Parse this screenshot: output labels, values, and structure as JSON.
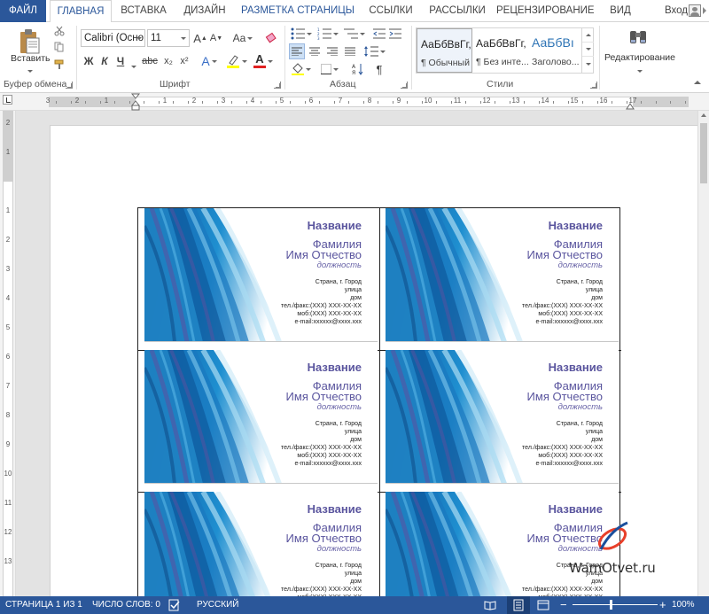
{
  "tabs": [
    {
      "label": "ФАЙЛ",
      "state": "file"
    },
    {
      "label": "ГЛАВНАЯ",
      "state": "active"
    },
    {
      "label": "ВСТАВКА",
      "state": ""
    },
    {
      "label": "ДИЗАЙН",
      "state": ""
    },
    {
      "label": "РАЗМЕТКА СТРАНИЦЫ",
      "state": "blue"
    },
    {
      "label": "ССЫЛКИ",
      "state": ""
    },
    {
      "label": "РАССЫЛКИ",
      "state": ""
    },
    {
      "label": "РЕЦЕНЗИРОВАНИЕ",
      "state": ""
    },
    {
      "label": "ВИД",
      "state": ""
    }
  ],
  "signin": "Вход",
  "ribbon": {
    "clipboard": {
      "paste_label": "Вставить",
      "group_label": "Буфер обмена"
    },
    "font": {
      "font_name": "Calibri (Осно",
      "font_size": "11",
      "grow": "A",
      "shrink": "A",
      "change_case": "Aa",
      "bold": "Ж",
      "italic": "К",
      "underline": "Ч",
      "strike": "abc",
      "subscript": "x₂",
      "superscript": "x²",
      "effects": "A",
      "color_letter": "A",
      "group_label": "Шрифт"
    },
    "paragraph": {
      "pilcrow": "¶",
      "group_label": "Абзац"
    },
    "styles": {
      "items": [
        {
          "sample": "АаБбВвГг,",
          "name": "¶ Обычный"
        },
        {
          "sample": "АаБбВвГг,",
          "name": "¶ Без инте..."
        },
        {
          "sample": "АаБбВı",
          "name": "Заголово..."
        }
      ],
      "group_label": "Стили"
    },
    "editing": {
      "label": "Редактирование"
    }
  },
  "ruler": {
    "h_numbers": [
      "3",
      "2",
      "1",
      "1",
      "2",
      "3",
      "4",
      "5",
      "6",
      "7",
      "8",
      "9",
      "10",
      "11",
      "12",
      "13",
      "14",
      "15",
      "16",
      "17"
    ],
    "v_numbers": [
      "2",
      "1",
      "1",
      "2",
      "3",
      "4",
      "5",
      "6",
      "7",
      "8",
      "9",
      "10",
      "11",
      "12",
      "13",
      "14"
    ]
  },
  "card": {
    "title": "Название",
    "surname": "Фамилия",
    "name": "Имя Отчество",
    "position": "должность",
    "lines": [
      "Страна, г. Город",
      "улица",
      "дом",
      "тел./факс:(XXX) XXX-XX-XX",
      "моб:(XXX) XXX-XX-XX",
      "e-mail:xxxxxx@xxxx.xxx"
    ]
  },
  "watermark": "WamOtvet.ru",
  "status": {
    "page": "СТРАНИЦА 1 ИЗ 1",
    "words": "ЧИСЛО СЛОВ: 0",
    "language": "РУССКИЙ",
    "zoom": "100%"
  },
  "colors": {
    "accent": "#2b579a",
    "card_text": "#5a559e"
  }
}
